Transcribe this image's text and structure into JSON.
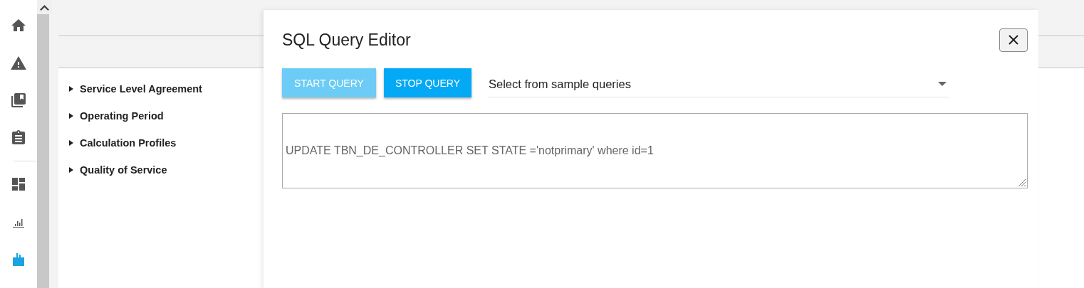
{
  "nav": {
    "items": [
      {
        "kind": "home",
        "selected": false
      },
      {
        "kind": "warning",
        "selected": false
      },
      {
        "kind": "library",
        "selected": false
      },
      {
        "kind": "clipboard",
        "selected": false
      },
      {
        "kind": "dashboard",
        "selected": false
      },
      {
        "kind": "chart",
        "selected": false
      },
      {
        "kind": "database",
        "selected": true
      }
    ]
  },
  "tree": {
    "items": [
      {
        "label": "Service Level Agreement",
        "expanded": false
      },
      {
        "label": "Operating Period",
        "expanded": false
      },
      {
        "label": "Calculation Profiles",
        "expanded": false
      },
      {
        "label": "Quality of Service",
        "expanded": false
      }
    ]
  },
  "dialog": {
    "title": "SQL Query Editor",
    "buttons": [
      {
        "label": "START QUERY",
        "disabled": true
      },
      {
        "label": "STOP QUERY",
        "disabled": false
      }
    ],
    "sample_select": {
      "placeholder": "Select from sample queries"
    },
    "query": {
      "value": "UPDATE TBN_DE_CONTROLLER SET STATE ='notprimary' where id=1"
    }
  }
}
